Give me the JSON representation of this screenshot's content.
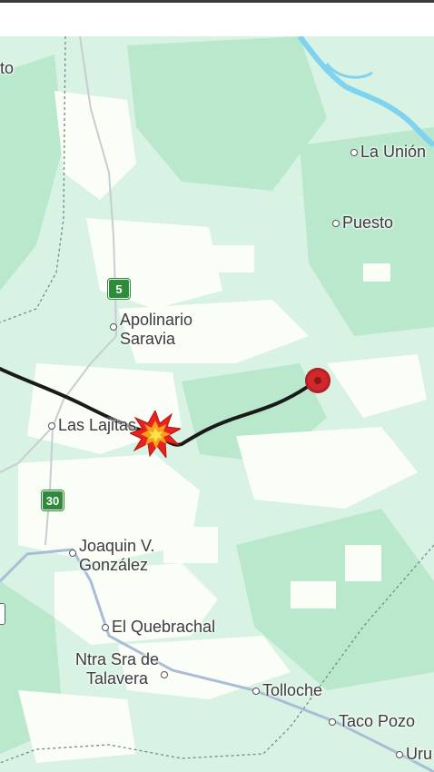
{
  "map": {
    "places": {
      "pto": "to",
      "la_union": "La Unión",
      "puesto": "Puesto",
      "apolinario_1": "Apolinario",
      "apolinario_2": "Saravia",
      "las_lajitas": "Las Lajitas",
      "joaquin_1": "Joaquin V.",
      "joaquin_2": "González",
      "el_quebrachal": "El Quebrachal",
      "ntra_1": "Ntra Sra de",
      "ntra_2": "Talavera",
      "tolloche": "Tolloche",
      "taco_pozo": "Taco Pozo",
      "uru": "Uru"
    },
    "route_shields": {
      "r5": "5",
      "r30": "30"
    },
    "icons": {
      "explosion": "explosion-icon",
      "destination": "destination-pin-icon"
    },
    "colors": {
      "land": "#d8f3e3",
      "cleared_land": "#fbfdf7",
      "river": "#7fd3f0",
      "route_line": "#1a1a1a",
      "pin": "#d0282b",
      "shield": "#2e8b3a"
    }
  }
}
